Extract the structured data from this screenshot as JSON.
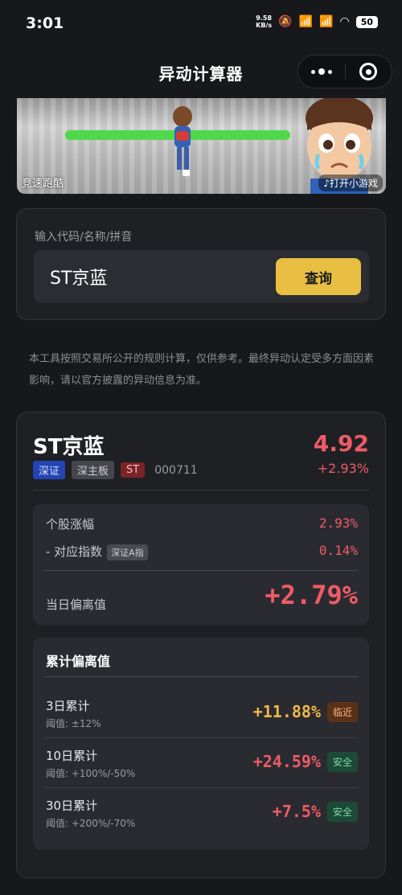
{
  "status_bar": {
    "time": "3:01",
    "speed_value": "9.58",
    "speed_unit": "KB/s",
    "battery": "50"
  },
  "header": {
    "title": "异动计算器"
  },
  "ad": {
    "label": "竞速跑酷",
    "play_label": "打开小游戏"
  },
  "search": {
    "hint": "输入代码/名称/拼音",
    "value": "ST京蓝",
    "button_label": "查询"
  },
  "disclaimer": "本工具按照交易所公开的规则计算，仅供参考。最终异动认定受多方面因素影响，请以官方披露的异动信息为准。",
  "stock": {
    "name": "ST京蓝",
    "price": "4.92",
    "change": "+2.93%",
    "exchange_tag": "深证",
    "board_tag": "深主板",
    "st_tag": "ST",
    "code": "000711"
  },
  "daily": {
    "stock_change_label": "个股涨幅",
    "stock_change_value": "2.93%",
    "index_label": "- 对应指数",
    "index_tag": "深证A指",
    "index_value": "0.14%",
    "deviation_label": "当日偏离值",
    "deviation_value": "+2.79%"
  },
  "cumulative": {
    "title": "累计偏离值",
    "rows": [
      {
        "label": "3日累计",
        "threshold": "阈值: ±12%",
        "value": "+11.88%",
        "badge": "临近",
        "status": "near"
      },
      {
        "label": "10日累计",
        "threshold": "阈值: +100%/-50%",
        "value": "+24.59%",
        "badge": "安全",
        "status": "safe"
      },
      {
        "label": "30日累计",
        "threshold": "阈值: +200%/-70%",
        "value": "+7.5%",
        "badge": "安全",
        "status": "safe"
      }
    ]
  },
  "colors": {
    "accent": "#e8bf42",
    "up": "#ef5b66",
    "warning": "#f0b84a",
    "safe": "#7fd8a9"
  }
}
